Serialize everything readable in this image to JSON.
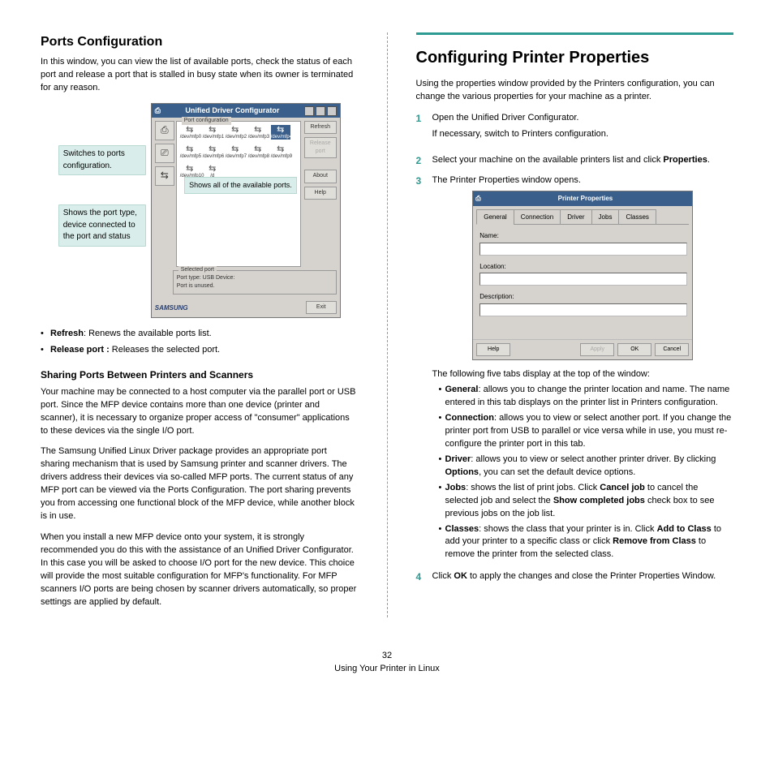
{
  "left": {
    "heading": "Ports Configuration",
    "intro": "In this window, you can view the list of available ports, check the status of each port and release a port that is stalled in busy state when its owner is terminated for any reason.",
    "callout_switch": "Switches to ports configuration.",
    "callout_status": "Shows the port type, device connected to the port and status",
    "callout_shows_all": "Shows all of the available ports.",
    "udc_title": "Unified Driver Configurator",
    "port_conf_label": "Port configuration",
    "ports": [
      "/dev/mfp0",
      "/dev/mfp1",
      "/dev/mfp2",
      "/dev/mfp3",
      "/dev/mfp4",
      "/dev/mfp5",
      "/dev/mfp6",
      "/dev/mfp7",
      "/dev/mfp8",
      "/dev/mfp9",
      "/dev/mfp10",
      "/d"
    ],
    "btn_refresh": "Refresh",
    "btn_release": "Release port",
    "btn_about": "About",
    "btn_help": "Help",
    "btn_exit": "Exit",
    "selport_label": "Selected port",
    "selport_type": "Port type: USB   Device:",
    "selport_state": "Port is unused.",
    "logo": "SAMSUNG",
    "bullet_refresh_label": "Refresh",
    "bullet_refresh_text": ": Renews the available ports list.",
    "bullet_release_label": "Release port :",
    "bullet_release_text": " Releases the selected port.",
    "sharing_heading": "Sharing Ports Between Printers and Scanners",
    "sharing_p1": "Your machine may be connected to a host computer via the parallel port or USB port. Since the MFP device contains more than one device (printer and scanner), it is necessary to organize proper access of \"consumer\" applications to these devices via the single I/O port.",
    "sharing_p2": "The Samsung Unified Linux Driver package provides an appropriate port sharing mechanism that is used by Samsung printer and scanner drivers. The drivers address their devices via so-called MFP ports. The current status of any MFP port can be viewed via the Ports Configuration. The port sharing prevents you from accessing one functional block of the MFP device, while another block is in use.",
    "sharing_p3": "When you install a new MFP device onto your system, it is strongly recommended you do this with the assistance of an Unified Driver Configurator. In this case you will be asked to choose I/O port for the new device. This choice will provide the most suitable configuration for MFP's functionality. For MFP scanners I/O ports are being chosen by scanner drivers automatically, so proper settings are applied by default."
  },
  "right": {
    "heading": "Configuring Printer Properties",
    "intro": "Using the properties window provided by the Printers configuration, you can change the various properties for your machine as a printer.",
    "step1": "Open the Unified Driver Configurator.",
    "step1b": "If necessary, switch to Printers configuration.",
    "step2a": "Select your machine on the available printers list and click ",
    "step2b": "Properties",
    "step2c": ".",
    "step3": "The Printer Properties window opens.",
    "pp_title": "Printer Properties",
    "tab_general": "General",
    "tab_connection": "Connection",
    "tab_driver": "Driver",
    "tab_jobs": "Jobs",
    "tab_classes": "Classes",
    "lbl_name": "Name:",
    "lbl_location": "Location:",
    "lbl_description": "Description:",
    "btn_help": "Help",
    "btn_apply": "Apply",
    "btn_ok": "OK",
    "btn_cancel": "Cancel",
    "tabs_intro": "The following five tabs display at the top of the window:",
    "desc_general_label": "General",
    "desc_general_text": ": allows you to change the printer location and name. The name entered in this tab displays on the printer list in Printers configuration.",
    "desc_connection_label": "Connection",
    "desc_connection_text": ": allows you to view or select another port. If you change the printer port from USB to parallel or vice versa while in use, you must re-configure the printer port in this tab.",
    "desc_driver_label": "Driver",
    "desc_driver_text_a": ": allows you to view or select another printer driver. By clicking ",
    "desc_driver_text_b": "Options",
    "desc_driver_text_c": ", you can set the default device options.",
    "desc_jobs_label": "Jobs",
    "desc_jobs_text_a": ": shows the list of print jobs. Click ",
    "desc_jobs_text_b": "Cancel job",
    "desc_jobs_text_c": " to cancel the selected job and select the ",
    "desc_jobs_text_d": "Show completed jobs",
    "desc_jobs_text_e": " check box to see previous jobs on the job list.",
    "desc_classes_label": "Classes",
    "desc_classes_text_a": ": shows the class that your printer is in. Click ",
    "desc_classes_text_b": "Add to Class",
    "desc_classes_text_c": " to add your printer to a specific class or click ",
    "desc_classes_text_d": "Remove from Class",
    "desc_classes_text_e": " to remove the printer from the selected class.",
    "step4a": "Click ",
    "step4b": "OK",
    "step4c": " to apply the changes and close the Printer Properties Window."
  },
  "footer": {
    "page": "32",
    "chapter": "Using Your Printer in Linux"
  }
}
